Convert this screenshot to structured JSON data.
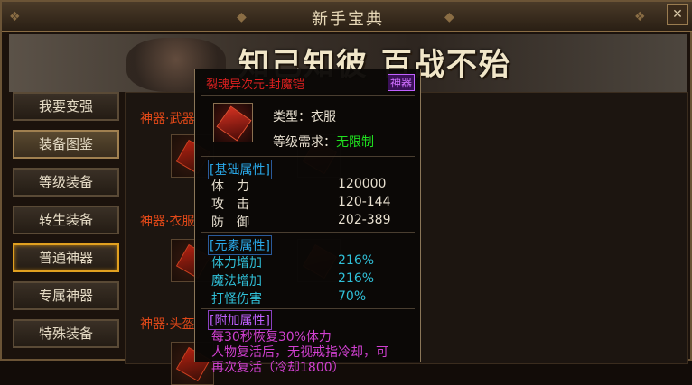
{
  "window": {
    "title": "新手宝典",
    "close_glyph": "✕"
  },
  "banner": {
    "text": "知己知彼  百战不殆"
  },
  "sidebar": {
    "items": [
      {
        "label": "我要变强"
      },
      {
        "label": "装备图鉴"
      },
      {
        "label": "等级装备"
      },
      {
        "label": "转生装备"
      },
      {
        "label": "普通神器"
      },
      {
        "label": "专属神器"
      },
      {
        "label": "特殊装备"
      }
    ]
  },
  "main": {
    "categories": [
      {
        "label": "神器·武器"
      },
      {
        "label": "神器·衣服"
      },
      {
        "label": "神器·头盔"
      }
    ]
  },
  "tooltip": {
    "name": "裂魂异次元-封魔铠",
    "badge": "神器",
    "type_label": "类型：",
    "type_value": "衣服",
    "level_label": "等级需求：",
    "level_value": "无限制",
    "base_header": "[基础属性]",
    "base": [
      {
        "label": "体　力",
        "value": "120000"
      },
      {
        "label": "攻　击",
        "value": "120-144"
      },
      {
        "label": "防　御",
        "value": "202-389"
      }
    ],
    "element_header": "[元素属性]",
    "element": [
      {
        "label": "体力增加",
        "value": "216%"
      },
      {
        "label": "魔法增加",
        "value": "216%"
      },
      {
        "label": "打怪伤害",
        "value": "70%"
      }
    ],
    "extra_header": "[附加属性]",
    "extra": [
      "每30秒恢复30%体力",
      "人物复活后，无视戒指冷却，可",
      "再次复活（冷却1800）"
    ]
  },
  "colors": {
    "accent": "#e0a020",
    "red": "#e04818",
    "cyan": "#30c0d8",
    "purple": "#c060ff"
  }
}
